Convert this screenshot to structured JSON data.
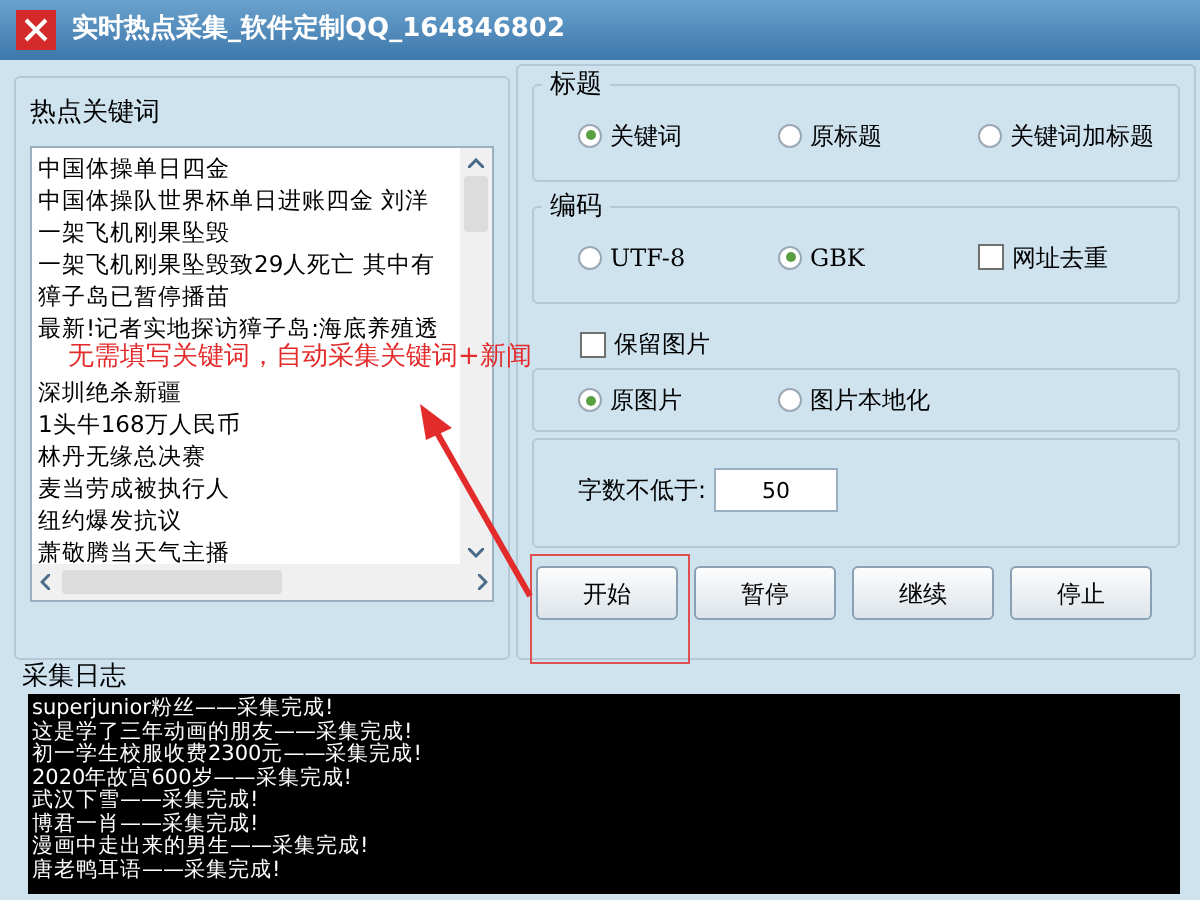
{
  "window": {
    "title": "实时热点采集_软件定制QQ_164846802"
  },
  "keywords": {
    "title": "热点关键词",
    "items": [
      "中国体操单日四金",
      "中国体操队世界杯单日进账四金 刘洋",
      "一架飞机刚果坠毁",
      "一架飞机刚果坠毁致29人死亡 其中有",
      "獐子岛已暂停播苗",
      "最新!记者实地探访獐子岛:海底养殖透",
      "深圳绝杀新疆",
      "1头牛168万人民币",
      "林丹无缘总决赛",
      "麦当劳成被执行人",
      "纽约爆发抗议",
      "萧敬腾当天气主播"
    ]
  },
  "title_group": {
    "title": "标题",
    "options": [
      {
        "label": "关键词",
        "selected": true
      },
      {
        "label": "原标题",
        "selected": false
      },
      {
        "label": "关键词加标题",
        "selected": false
      }
    ]
  },
  "encoding_group": {
    "title": "编码",
    "options": [
      {
        "label": "UTF-8",
        "selected": false
      },
      {
        "label": "GBK",
        "selected": true
      }
    ],
    "dedupe": {
      "label": "网址去重",
      "checked": false
    }
  },
  "keep_images": {
    "label": "保留图片",
    "checked": false
  },
  "image_options": [
    {
      "label": "原图片",
      "selected": true
    },
    {
      "label": "图片本地化",
      "selected": false
    }
  ],
  "min_chars": {
    "label": "字数不低于:",
    "value": "50"
  },
  "buttons": [
    "开始",
    "暂停",
    "继续",
    "停止"
  ],
  "log": {
    "title": "采集日志",
    "lines": [
      "superjunior粉丝——采集完成!",
      "这是学了三年动画的朋友——采集完成!",
      "初一学生校服收费2300元——采集完成!",
      "2020年故宫600岁——采集完成!",
      "武汉下雪——采集完成!",
      "博君一肖——采集完成!",
      "漫画中走出来的男生——采集完成!",
      "唐老鸭耳语——采集完成!"
    ]
  },
  "annotation": {
    "text": "无需填写关键词，自动采集关键词+新闻"
  }
}
